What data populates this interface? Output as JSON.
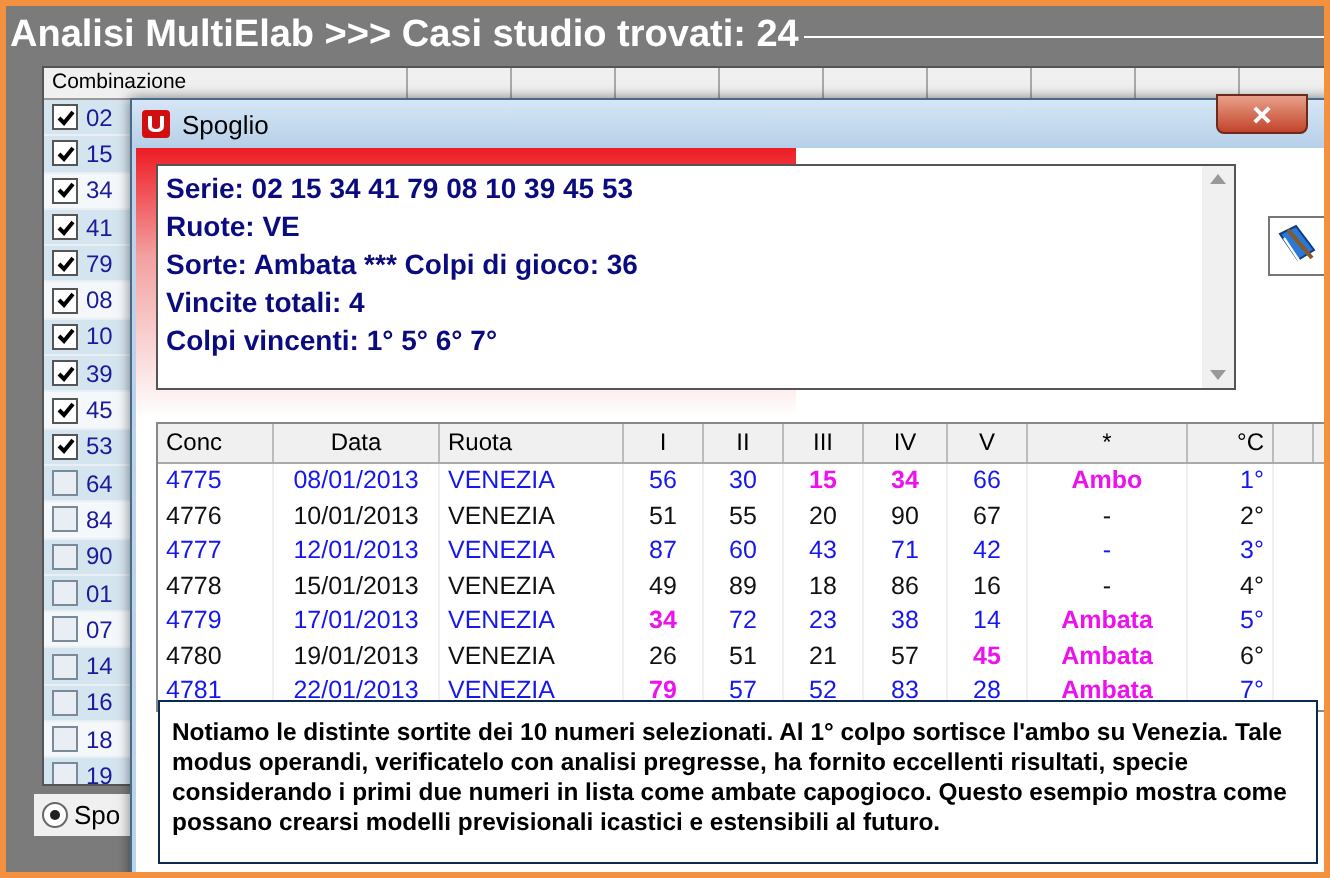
{
  "window": {
    "title": "Analisi MultiElab >>> Casi studio trovati: 24"
  },
  "list": {
    "column": "Combinazione",
    "items": [
      {
        "label": "02",
        "checked": true
      },
      {
        "label": "15",
        "checked": true
      },
      {
        "label": "34",
        "checked": true
      },
      {
        "label": "41",
        "checked": true
      },
      {
        "label": "79",
        "checked": true
      },
      {
        "label": "08",
        "checked": true
      },
      {
        "label": "10",
        "checked": true
      },
      {
        "label": "39",
        "checked": true
      },
      {
        "label": "45",
        "checked": true
      },
      {
        "label": "53",
        "checked": true
      },
      {
        "label": "64",
        "checked": false
      },
      {
        "label": "84",
        "checked": false
      },
      {
        "label": "90",
        "checked": false
      },
      {
        "label": "01",
        "checked": false
      },
      {
        "label": "07",
        "checked": false
      },
      {
        "label": "14",
        "checked": false
      },
      {
        "label": "16",
        "checked": false
      },
      {
        "label": "18",
        "checked": false
      },
      {
        "label": "19",
        "checked": false
      }
    ]
  },
  "option": {
    "label": "Spo",
    "selected": true
  },
  "dialog": {
    "title": "Spoglio",
    "summary": [
      "Serie: 02 15 34 41 79 08 10 39 45 53",
      "Ruote: VE",
      "Sorte: Ambata *** Colpi di gioco: 36",
      "Vincite totali: 4",
      "Colpi vincenti: 1° 5° 6° 7°"
    ],
    "table": {
      "columns": [
        "Conc",
        "Data",
        "Ruota",
        "I",
        "II",
        "III",
        "IV",
        "V",
        "*",
        "°C"
      ],
      "rows": [
        {
          "highlight": true,
          "cells": [
            {
              "text": "4775",
              "hit": false
            },
            {
              "text": "08/01/2013",
              "hit": false
            },
            {
              "text": "VENEZIA",
              "hit": false
            },
            {
              "text": "56",
              "hit": false
            },
            {
              "text": "30",
              "hit": false
            },
            {
              "text": "15",
              "hit": true
            },
            {
              "text": "34",
              "hit": true
            },
            {
              "text": "66",
              "hit": false
            },
            {
              "text": "Ambo",
              "hit": true
            },
            {
              "text": "1°",
              "hit": false
            }
          ]
        },
        {
          "highlight": false,
          "cells": [
            {
              "text": "4776",
              "hit": false
            },
            {
              "text": "10/01/2013",
              "hit": false
            },
            {
              "text": "VENEZIA",
              "hit": false
            },
            {
              "text": "51",
              "hit": false
            },
            {
              "text": "55",
              "hit": false
            },
            {
              "text": "20",
              "hit": false
            },
            {
              "text": "90",
              "hit": false
            },
            {
              "text": "67",
              "hit": false
            },
            {
              "text": "-",
              "hit": false
            },
            {
              "text": "2°",
              "hit": false
            }
          ]
        },
        {
          "highlight": true,
          "cells": [
            {
              "text": "4777",
              "hit": false
            },
            {
              "text": "12/01/2013",
              "hit": false
            },
            {
              "text": "VENEZIA",
              "hit": false
            },
            {
              "text": "87",
              "hit": false
            },
            {
              "text": "60",
              "hit": false
            },
            {
              "text": "43",
              "hit": false
            },
            {
              "text": "71",
              "hit": false
            },
            {
              "text": "42",
              "hit": false
            },
            {
              "text": "-",
              "hit": false
            },
            {
              "text": "3°",
              "hit": false
            }
          ]
        },
        {
          "highlight": false,
          "cells": [
            {
              "text": "4778",
              "hit": false
            },
            {
              "text": "15/01/2013",
              "hit": false
            },
            {
              "text": "VENEZIA",
              "hit": false
            },
            {
              "text": "49",
              "hit": false
            },
            {
              "text": "89",
              "hit": false
            },
            {
              "text": "18",
              "hit": false
            },
            {
              "text": "86",
              "hit": false
            },
            {
              "text": "16",
              "hit": false
            },
            {
              "text": "-",
              "hit": false
            },
            {
              "text": "4°",
              "hit": false
            }
          ]
        },
        {
          "highlight": true,
          "cells": [
            {
              "text": "4779",
              "hit": false
            },
            {
              "text": "17/01/2013",
              "hit": false
            },
            {
              "text": "VENEZIA",
              "hit": false
            },
            {
              "text": "34",
              "hit": true
            },
            {
              "text": "72",
              "hit": false
            },
            {
              "text": "23",
              "hit": false
            },
            {
              "text": "38",
              "hit": false
            },
            {
              "text": "14",
              "hit": false
            },
            {
              "text": "Ambata",
              "hit": true
            },
            {
              "text": "5°",
              "hit": false
            }
          ]
        },
        {
          "highlight": false,
          "cells": [
            {
              "text": "4780",
              "hit": false
            },
            {
              "text": "19/01/2013",
              "hit": false
            },
            {
              "text": "VENEZIA",
              "hit": false
            },
            {
              "text": "26",
              "hit": false
            },
            {
              "text": "51",
              "hit": false
            },
            {
              "text": "21",
              "hit": false
            },
            {
              "text": "57",
              "hit": false
            },
            {
              "text": "45",
              "hit": true
            },
            {
              "text": "Ambata",
              "hit": true
            },
            {
              "text": "6°",
              "hit": false
            }
          ]
        },
        {
          "highlight": true,
          "cells": [
            {
              "text": "4781",
              "hit": false
            },
            {
              "text": "22/01/2013",
              "hit": false
            },
            {
              "text": "VENEZIA",
              "hit": false
            },
            {
              "text": "79",
              "hit": true
            },
            {
              "text": "57",
              "hit": false
            },
            {
              "text": "52",
              "hit": false
            },
            {
              "text": "83",
              "hit": false
            },
            {
              "text": "28",
              "hit": false
            },
            {
              "text": "Ambata",
              "hit": true
            },
            {
              "text": "7°",
              "hit": false
            }
          ]
        }
      ]
    },
    "note": "Notiamo le distinte sortite dei 10 numeri selezionati. Al 1° colpo sortisce l'ambo su Venezia. Tale modus operandi, verificatelo con analisi pregresse, ha fornito eccellenti risultati, specie considerando i primi due numeri in lista come ambate capogioco. Questo esempio mostra come possano crearsi modelli previsionali icastici e estensibili al futuro."
  }
}
